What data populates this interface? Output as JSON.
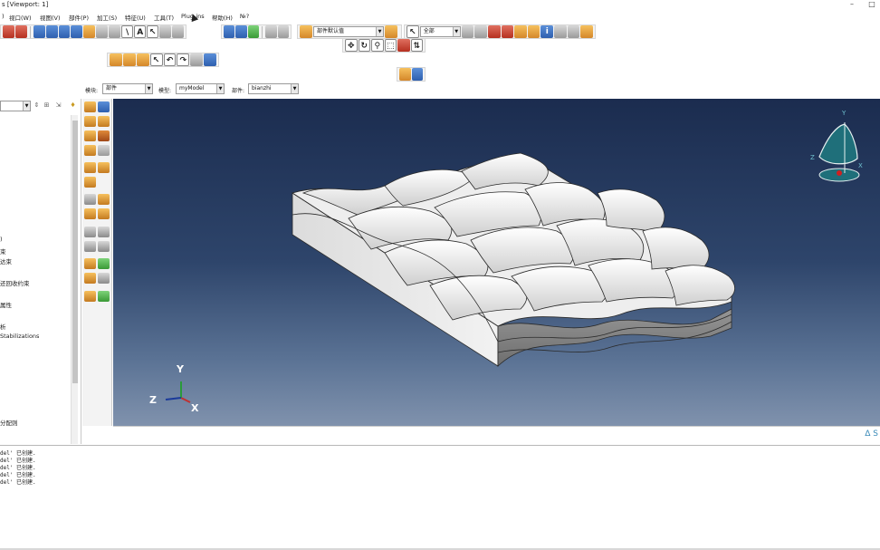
{
  "window": {
    "title": "s [Viewport: 1]",
    "min_glyph": "–",
    "max_glyph": "□"
  },
  "menu": {
    "items": [
      {
        "label": ")"
      },
      {
        "label": "视口(W)"
      },
      {
        "label": "视图(V)"
      },
      {
        "label": "部件(P)"
      },
      {
        "label": "加工(S)"
      },
      {
        "label": "特征(U)"
      },
      {
        "label": "工具(T)"
      },
      {
        "label": "Plug-ins"
      },
      {
        "label": "帮助(H)"
      },
      {
        "label": "№?"
      }
    ]
  },
  "toolbar": {
    "render_style_combo": "部件默认值",
    "selection_combo": "全部",
    "info_glyph": "i",
    "text_glyph": "A",
    "help_glyph": "?"
  },
  "context": {
    "module_label": "模块:",
    "module_value": "部件",
    "model_label": "模型:",
    "model_value": "myModel",
    "part_label": "部件:",
    "part_value": "bianzhi"
  },
  "tree": {
    "items": [
      {
        "label": ")"
      },
      {
        "label": "束"
      },
      {
        "label": "达束"
      },
      {
        "label": "还回收约束"
      },
      {
        "label": "属性"
      },
      {
        "label": "析"
      },
      {
        "label": "Stabilizations"
      },
      {
        "label": "分配则"
      }
    ]
  },
  "viewport": {
    "triad": {
      "x": "X",
      "y": "Y",
      "z": "Z"
    },
    "compass": {
      "x": "X",
      "y": "Y",
      "z": "Z"
    }
  },
  "brand": {
    "text": "∆ S"
  },
  "messages": {
    "lines": [
      "del' 已创建.",
      "del' 已创建.",
      "del' 已创建.",
      "del' 已创建.",
      "del' 已创建."
    ]
  },
  "colors": {
    "viewport_top": "#1b2c4f",
    "viewport_bottom": "#8092ad",
    "part_face": "#e9e9e9",
    "part_edge": "#2b2b2b",
    "triad_x": "#1a3a9a",
    "triad_y": "#2a9a3a",
    "triad_z": "#c03030",
    "compass_fill": "#1f6f7a"
  }
}
